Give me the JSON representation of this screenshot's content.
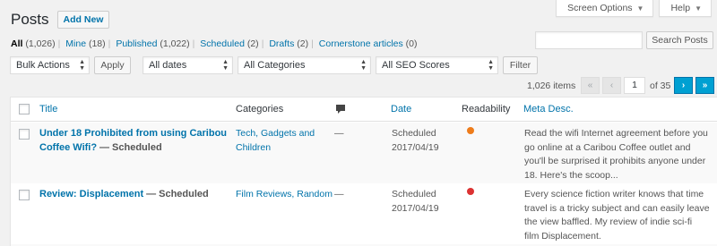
{
  "screen_meta": {
    "screen_options": "Screen Options",
    "help": "Help"
  },
  "header": {
    "title": "Posts",
    "add_new": "Add New"
  },
  "views": [
    {
      "label": "All",
      "count": "(1,026)",
      "current": true
    },
    {
      "label": "Mine",
      "count": "(18)"
    },
    {
      "label": "Published",
      "count": "(1,022)"
    },
    {
      "label": "Scheduled",
      "count": "(2)"
    },
    {
      "label": "Drafts",
      "count": "(2)"
    },
    {
      "label": "Cornerstone articles",
      "count": "(0)"
    }
  ],
  "search": {
    "button": "Search Posts",
    "value": ""
  },
  "filters": {
    "bulk_actions": "Bulk Actions",
    "apply": "Apply",
    "dates": "All dates",
    "categories": "All Categories",
    "seo_scores": "All SEO Scores",
    "filter": "Filter"
  },
  "pagination": {
    "items": "1,026 items",
    "first": "«",
    "prev": "‹",
    "current_page": "1",
    "of_pages": "of 35",
    "next": "›",
    "last": "»"
  },
  "columns": {
    "title": "Title",
    "categories": "Categories",
    "comments_icon": "comment-bubble-icon",
    "date": "Date",
    "readability": "Readability",
    "meta_desc": "Meta Desc."
  },
  "colors": {
    "link": "#0073aa",
    "readability_ok": "#ee7c1b",
    "readability_bad": "#dc3232"
  },
  "posts": [
    {
      "title_line1": "Under 18 Prohibited from using Caribou",
      "title_line2": "Coffee Wifi?",
      "state": "— Scheduled",
      "categories_line1": "Tech, Gadgets and",
      "categories_line2": "Children",
      "comments": "—",
      "date_status": "Scheduled",
      "date": "2017/04/19",
      "readability": "ok",
      "meta_line1": "Read the wifi Internet agreement before you",
      "meta_line2": "go online at a Caribou Coffee outlet and",
      "meta_line3": "you'll be surprised it prohibits anyone under",
      "meta_line4": "18. Here's the scoop..."
    },
    {
      "title_line1": "Review: Displacement",
      "state": "— Scheduled",
      "categories_line1": "Film Reviews, Random",
      "comments": "—",
      "date_status": "Scheduled",
      "date": "2017/04/19",
      "readability": "bad",
      "meta_line1": "Every science fiction writer knows that time",
      "meta_line2": "travel is a tricky subject and can easily leave",
      "meta_line3": "the view baffled. My review of indie sci-fi",
      "meta_line4": "film Displacement."
    }
  ]
}
